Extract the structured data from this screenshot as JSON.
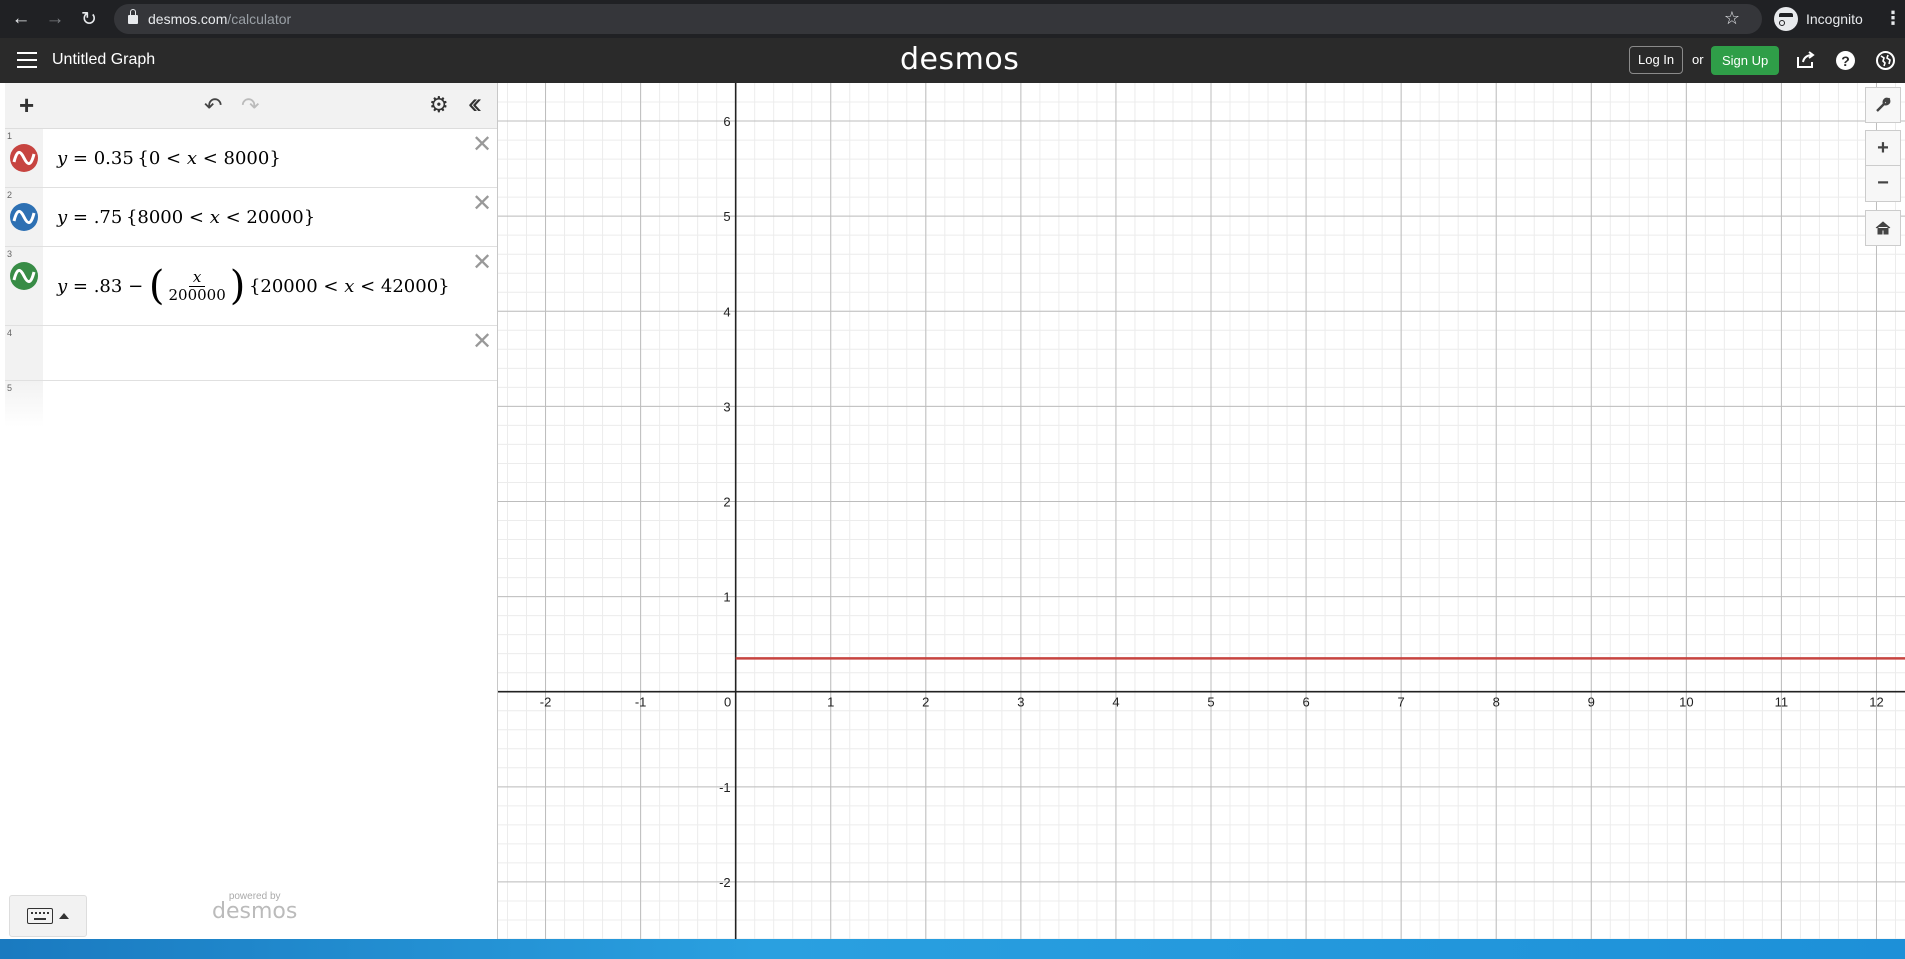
{
  "browser": {
    "url_host": "desmos.com",
    "url_path": "/calculator",
    "profile_label": "Incognito"
  },
  "header": {
    "graph_title": "Untitled Graph",
    "brand": "desmos",
    "login_label": "Log In",
    "or_text": "or",
    "signup_label": "Sign Up"
  },
  "expressions": [
    {
      "index": "1",
      "color": "#c74440",
      "latex_parts": {
        "lhs": "y",
        "value": "0.35",
        "lo": "0",
        "var": "x",
        "hi": "8000"
      }
    },
    {
      "index": "2",
      "color": "#2d70b3",
      "latex_parts": {
        "lhs": "y",
        "value": ".75",
        "lo": "8000",
        "var": "x",
        "hi": "20000"
      }
    },
    {
      "index": "3",
      "color": "#388c46",
      "latex_parts": {
        "lhs": "y",
        "value": ".83",
        "num": "x",
        "den": "200000",
        "lo": "20000",
        "var": "x",
        "hi": "42000"
      }
    },
    {
      "index": "4"
    },
    {
      "index": "5"
    }
  ],
  "footer": {
    "powered_by": "powered by",
    "powered_brand": "desmos"
  },
  "graph": {
    "x_ticks": [
      "-2",
      "-1",
      "0",
      "1",
      "2",
      "3",
      "4",
      "5",
      "6",
      "7",
      "8",
      "9",
      "10",
      "11",
      "12"
    ],
    "y_ticks": [
      "6",
      "5",
      "4",
      "3",
      "2",
      "1",
      "-1",
      "-2"
    ],
    "x_range": [
      -2.5,
      12.3
    ],
    "y_range": [
      -2.6,
      6.4
    ],
    "curve": {
      "color": "#c74440",
      "y": 0.35,
      "x_from": 0
    }
  },
  "icons": {
    "back": "arrow-left-icon",
    "forward": "arrow-right-icon",
    "reload": "reload-icon",
    "star": "star-icon",
    "menu": "hamburger-icon",
    "share": "share-icon",
    "help": "help-icon",
    "language": "globe-icon",
    "wrench": "wrench-icon",
    "zoom_in": "zoom-in-icon",
    "zoom_out": "zoom-out-icon",
    "home": "home-icon"
  }
}
